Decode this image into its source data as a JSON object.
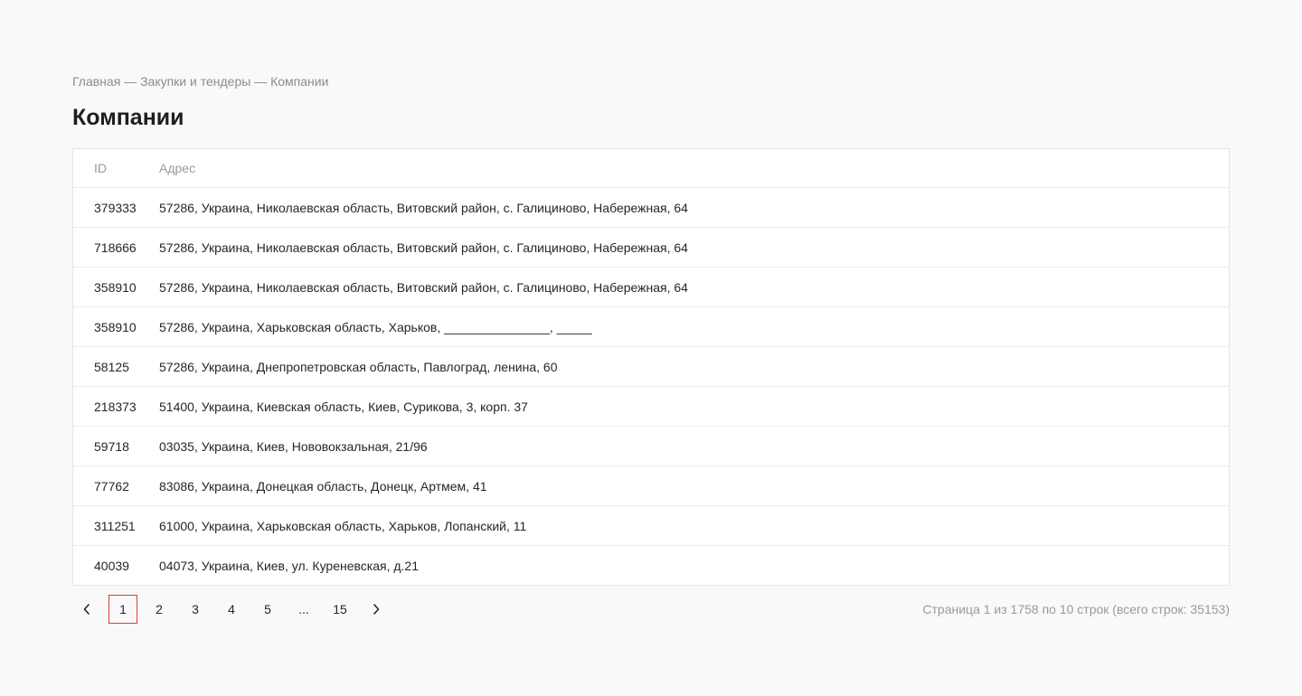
{
  "breadcrumb": {
    "items": [
      "Главная",
      "Закупки и тендеры",
      "Компании"
    ],
    "separator": "—"
  },
  "page_title": "Компании",
  "table": {
    "columns": {
      "id": "ID",
      "address": "Адрес"
    },
    "rows": [
      {
        "id": "379333",
        "address": "57286, Украина, Николаевская область, Витовский район, с. Галициново, Набережная, 64"
      },
      {
        "id": "718666",
        "address": "57286, Украина, Николаевская область, Витовский район, с. Галициново, Набережная, 64"
      },
      {
        "id": "358910",
        "address": "57286, Украина, Николаевская область, Витовский район, с. Галициново, Набережная, 64"
      },
      {
        "id": "358910",
        "address": "57286, Украина, Харьковская область, Харьков, _______________, _____"
      },
      {
        "id": "58125",
        "address": "57286, Украина, Днепропетровская область, Павлоград, ленина, 60"
      },
      {
        "id": "218373",
        "address": "51400, Украина, Киевская область, Киев, Сурикова, 3, корп. 37"
      },
      {
        "id": "59718",
        "address": "03035, Украина, Киев, Нововокзальная, 21/96"
      },
      {
        "id": "77762",
        "address": "83086, Украина, Донецкая область, Донецк, Артмем, 41"
      },
      {
        "id": "311251",
        "address": "61000, Украина, Харьковская область, Харьков, Лопанский, 11"
      },
      {
        "id": "40039",
        "address": "04073, Украина, Киев, ул. Куреневская, д.21"
      }
    ]
  },
  "pagination": {
    "prev_icon": "chevron-left-icon",
    "next_icon": "chevron-right-icon",
    "pages": [
      "1",
      "2",
      "3",
      "4",
      "5",
      "...",
      "15"
    ],
    "active_page": "1",
    "accent_color": "#d9432b",
    "info": "Страница 1 из 1758 по 10 строк (всего строк: 35153)"
  }
}
